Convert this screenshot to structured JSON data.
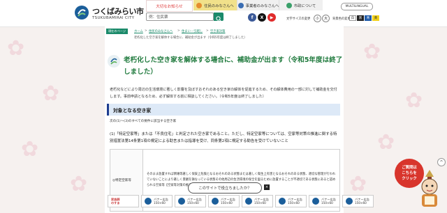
{
  "header": {
    "logo_ja": "つくばみらい市",
    "logo_en": "TSUKUBAMIRAI CITY",
    "notice_tab": "大切なお知らせ",
    "search_placeholder": "例：住民票",
    "tabs": [
      {
        "label": "住民のみなさんへ",
        "color": "#f1e18a"
      },
      {
        "label": "事業者のみなさんへ",
        "color": "#f0f0f0"
      },
      {
        "label": "市政について",
        "color": "#f0f0f0"
      }
    ],
    "multilingual": "MULTILINGUAL",
    "font_size_label": "文字サイズの変更",
    "font_small": "小",
    "font_large": "大",
    "bg_color_label": "背景色の変更",
    "bg_colors": [
      {
        "label": "白",
        "color": "#ffffff",
        "text": "#333333"
      },
      {
        "label": "黒",
        "color": "#222222",
        "text": "#ffffff"
      },
      {
        "label": "青",
        "color": "#1e5aa8",
        "text": "#ffffff"
      },
      {
        "label": "黄",
        "color": "#f2d11a",
        "text": "#333333"
      }
    ]
  },
  "breadcrumb": {
    "here_label": "現在のページ",
    "items": [
      "ホーム",
      "住民のみなさんへ",
      "住まい・引越し",
      "空き家対策"
    ],
    "current": "老朽化した空き家を解体する場合に、補助金が出ます（令和5年度は終了しました）"
  },
  "main": {
    "title": "老朽化した空き家を解体する場合に、補助金が出ます（令和5年度は終了しました）",
    "intro": "老朽化などにより周辺の生活環境に著しく影響を及ぼすおそれのある空き家の解体を促進するため、その解体費用の一部に対して補助金を交付します。事前申請となるため、必ず解体する前に相談してください。（令和5年度は終了しました）",
    "section_heading": "対象となる空き家",
    "para1": "次の(1)～(3)のすべての要件に該当する空き家",
    "para2": "(1)「特定空家等」または「不良住宅」と判定された空き家であること。ただし、特定空家等については、空家等対策の推進に関する特別措置法第14条第1項の規定による助言または指導を受け、同条第2項に規定する勧告を受けていないこと",
    "table": {
      "header": "◎特定空家等",
      "text": "そのまま放置すれば倒壊等著しく保安上危険となるおそれのある状態または著しく衛生上有害となるおそれのある状態、適切な管理が行われていないことにより著しく景観を損なっている状態その他周辺の生活環境の保全を図るために放置することが不適切である状態にあると認められる空家等【空家等対策の推進に関する特別措置法 第2条第2項に規定】"
    }
  },
  "survey": {
    "label": "このサイトで役立ちましたか？",
    "close": "×"
  },
  "banners": [
    {
      "label": "家族葬\nのすま"
    },
    {
      "label": "バナー広告\n150×60"
    },
    {
      "label": "バナー広告\n150×60"
    },
    {
      "label": "バナー広告\n150×60"
    },
    {
      "label": "バナー広告\n150×60"
    },
    {
      "label": "バナー広告\n150×60"
    },
    {
      "label": "バナー広告\n150×60"
    },
    {
      "label": "バナー広告\n150×60"
    }
  ],
  "chatbot": {
    "label": "ご質問は\nこちらを\nクリック"
  },
  "colors": {
    "brand_green": "#1b8a6a",
    "title_green": "#1f7a3d",
    "section_bg": "#dde9f7",
    "section_bar": "#1e3d8f",
    "chat_red": "#d8352c"
  }
}
